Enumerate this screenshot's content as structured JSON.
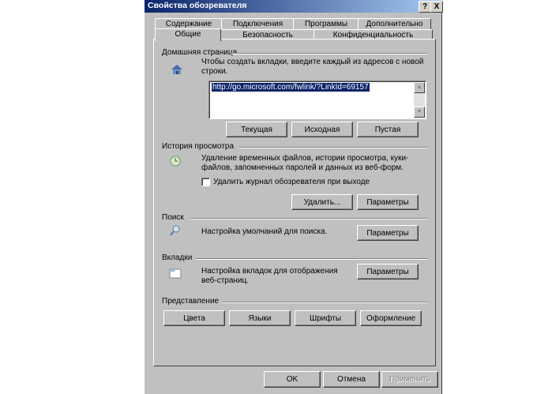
{
  "window": {
    "title": "Свойства обозревателя",
    "help_btn": "?",
    "close_btn": "X"
  },
  "tabs_row1": [
    "Содержание",
    "Подключения",
    "Программы",
    "Дополнительно"
  ],
  "tabs_row2": [
    "Общие",
    "Безопасность",
    "Конфиденциальность"
  ],
  "home": {
    "group_title": "Домашняя страница",
    "description": "Чтобы создать вкладки, введите каждый из адресов с новой строки.",
    "url": "http://go.microsoft.com/fwlink/?LinkId=69157",
    "btn_current": "Текущая",
    "btn_default": "Исходная",
    "btn_blank": "Пустая"
  },
  "history": {
    "group_title": "История просмотра",
    "description": "Удаление временных файлов, истории просмотра, куки-файлов, запомненных паролей и данных из веб-форм.",
    "checkbox_label": "Удалить журнал обозревателя при выходе",
    "btn_delete": "Удалить...",
    "btn_params": "Параметры"
  },
  "search": {
    "group_title": "Поиск",
    "description": "Настройка умолчаний для поиска.",
    "btn_params": "Параметры"
  },
  "tabs_group": {
    "group_title": "Вкладки",
    "description": "Настройка вкладок для отображения веб-страниц.",
    "btn_params": "Параметры"
  },
  "appearance": {
    "group_title": "Представление",
    "btn_colors": "Цвета",
    "btn_languages": "Языки",
    "btn_fonts": "Шрифты",
    "btn_design": "Оформление"
  },
  "footer": {
    "ok": "OK",
    "cancel": "Отмена",
    "apply": "Применить"
  }
}
